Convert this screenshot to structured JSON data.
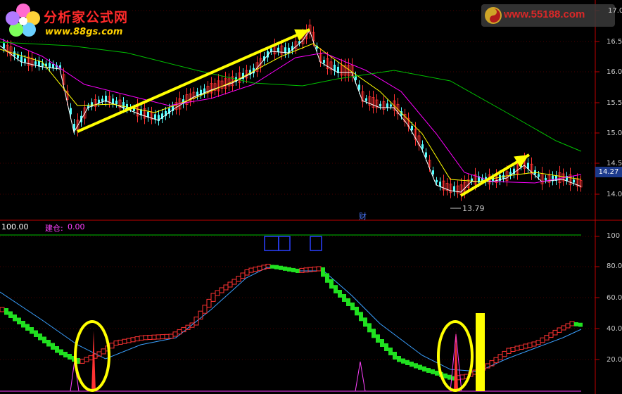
{
  "logo": {
    "brand": "分析家公式网",
    "site": "www.88gs.com",
    "watermark": "www.55188.com"
  },
  "price_panel": {
    "y_ticks": [
      "16.5",
      "16.0",
      "15.5",
      "15.0",
      "14.5",
      "14.0"
    ],
    "top_tick": "17.0",
    "current_price": "14.27",
    "low_marker": "13.79",
    "event_marker": "财"
  },
  "indicator_panel": {
    "value_label": "100.00",
    "build_label": "建仓:",
    "build_value": "0.00",
    "y_ticks": [
      "100",
      "80.0",
      "60.0",
      "40.0",
      "20.0"
    ]
  },
  "colors": {
    "up": "#ff3232",
    "down": "#54ffff",
    "ma5": "#ffffff",
    "ma10": "#ffff00",
    "ma20": "#ff00ff",
    "ma60": "#00c000",
    "arrow": "#ffff00",
    "axis": "#c00000",
    "build": "#ff40ff"
  }
}
